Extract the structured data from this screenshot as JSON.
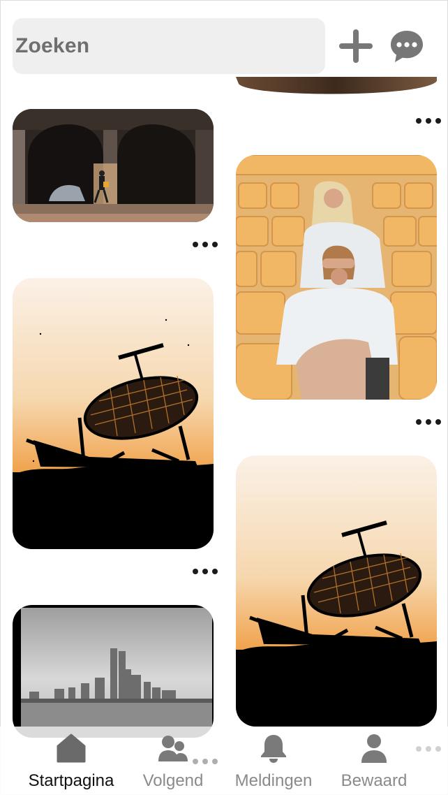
{
  "search": {
    "placeholder": "Zoeken"
  },
  "header": {
    "add_icon": "plus-icon",
    "message_icon": "chat-bubble-icon"
  },
  "pins": [
    {
      "id": "pin-top-partial",
      "description": "partial image cut at top"
    },
    {
      "id": "pin-arcade",
      "description": "person walking under stone arches"
    },
    {
      "id": "pin-stadium",
      "description": "two people seated in orange stadium seats"
    },
    {
      "id": "pin-radar-left",
      "description": "radar antenna silhouette at sunset"
    },
    {
      "id": "pin-radar-right",
      "description": "radar antenna silhouette at sunset"
    },
    {
      "id": "pin-skyline",
      "description": "black and white city skyline"
    }
  ],
  "more_icon": "more-horizontal-icon",
  "nav": {
    "items": [
      {
        "label": "Startpagina",
        "icon": "home-icon",
        "active": true
      },
      {
        "label": "Volgend",
        "icon": "people-icon",
        "active": false
      },
      {
        "label": "Meldingen",
        "icon": "bell-icon",
        "active": false
      },
      {
        "label": "Bewaard",
        "icon": "profile-icon",
        "active": false
      }
    ]
  },
  "colors": {
    "nav_active": "#111111",
    "nav_inactive": "#8a8a8a",
    "search_bg": "#efefef",
    "icon_gray": "#777777"
  }
}
